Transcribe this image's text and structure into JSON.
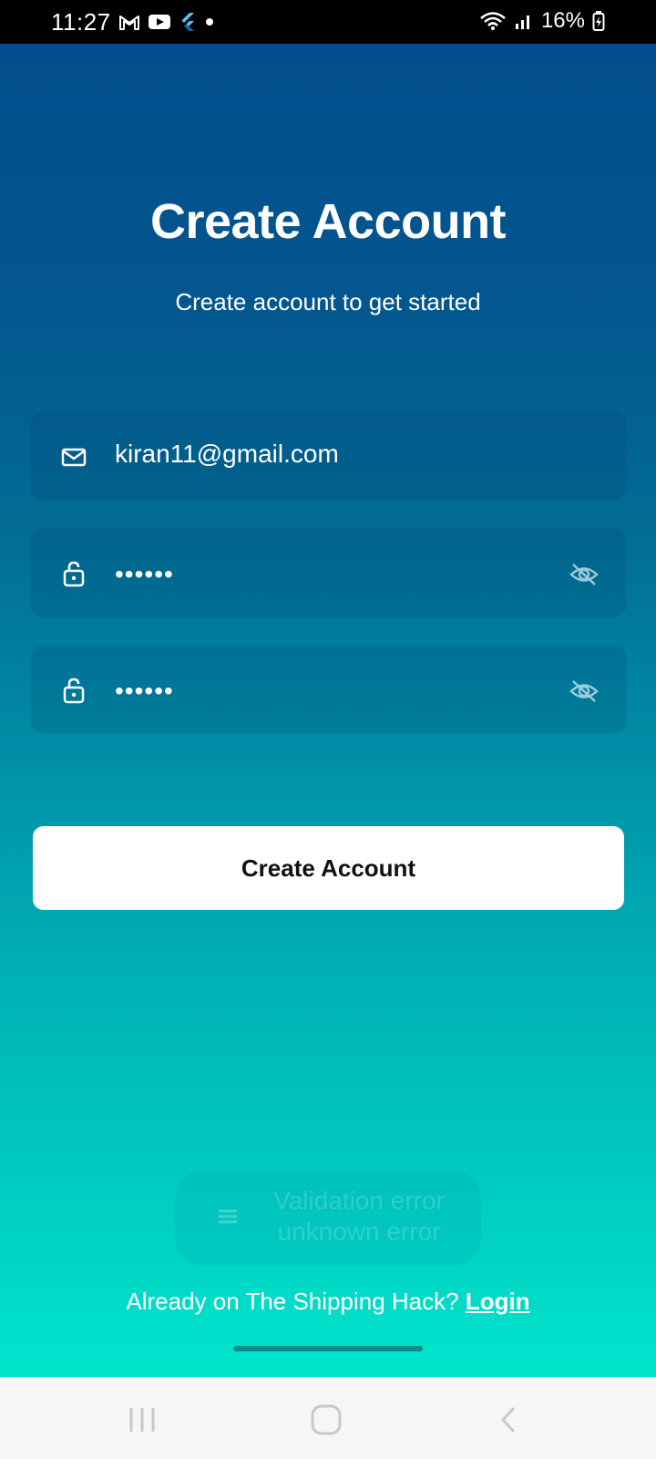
{
  "status_bar": {
    "time": "11:27",
    "battery": "16%",
    "icons_left": [
      "gmail-icon",
      "youtube-icon",
      "flutter-icon",
      "dot-icon"
    ],
    "icons_right": [
      "wifi-icon",
      "signal-icon",
      "battery-charging-icon"
    ]
  },
  "header": {
    "title": "Create Account",
    "subtitle": "Create account to get started"
  },
  "form": {
    "email": {
      "value": "kiran11@gmail.com",
      "icon": "mail-icon"
    },
    "password": {
      "value": "••••••",
      "icon": "lock-icon",
      "toggle_icon": "eye-off-icon"
    },
    "confirm_password": {
      "value": "••••••",
      "icon": "lock-icon",
      "toggle_icon": "eye-off-icon"
    },
    "submit_label": "Create Account"
  },
  "toast": {
    "line1": "Validation error",
    "line2": "unknown error"
  },
  "footer": {
    "prompt": "Already on The Shipping Hack?",
    "login_label": "Login"
  },
  "nav": {
    "buttons": [
      "recent-apps",
      "home",
      "back"
    ]
  },
  "colors": {
    "gradient_top": "#024e8c",
    "gradient_bottom": "#00e5cc",
    "button_bg": "#ffffff",
    "navbar_bg": "#f6f6f6"
  }
}
